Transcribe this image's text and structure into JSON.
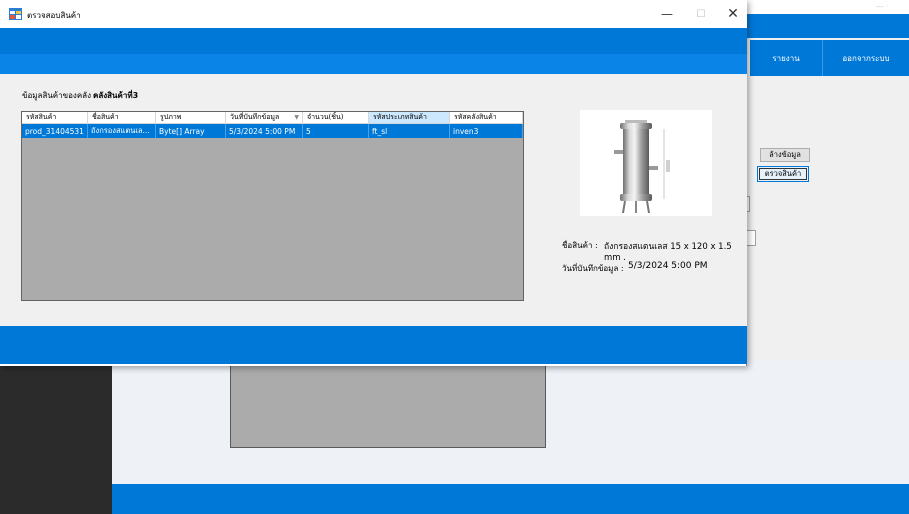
{
  "background_window": {
    "menu": {
      "report": "รายงาน",
      "logout": "ออกจากระบบ"
    },
    "buttons": {
      "clear": "ล้างข้อมูล",
      "check_product": "ตรวจสินค้า"
    }
  },
  "dialog": {
    "title": "ตรวจสอบสินค้า",
    "window_buttons": {
      "minimize": "—",
      "maximize": "☐",
      "close": "✕"
    },
    "warehouse_label": "ข้อมูลสินค้าของคลัง :",
    "warehouse_value": "คลังสินค้าที่3",
    "grid": {
      "columns": [
        "รหัสสินค้า",
        "ชื่อสินค้า",
        "รูปภาพ",
        "วันที่บันทึกข้อมูล",
        "จำนวน(ชิ้น)",
        "รหัสประเภทสินค้า",
        "รหัสคลังสินค้า"
      ],
      "sorted_column_indicator": "▼",
      "rows": [
        [
          "prod_31404531",
          "ถังกรองสแตนเล...",
          "Byte[] Array",
          "5/3/2024 5:00 PM",
          "5",
          "ft_sl",
          "inven3"
        ]
      ]
    },
    "product_name_label": "ชื่อสินค้า :",
    "product_name_value": "ถังกรองสแตนเลส 15 x 120 x 1.5 mm .",
    "record_date_label": "วันที่บันทึกข้อมูล :",
    "record_date_value": "5/3/2024 5:00 PM"
  }
}
